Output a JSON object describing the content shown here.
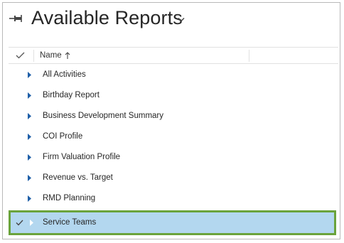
{
  "header": {
    "title": "Available Reports",
    "pin_icon": "pin-icon",
    "view_selector_icon": "chevron-down-icon"
  },
  "grid": {
    "select_all_icon": "checkmark-icon",
    "columns": [
      {
        "label": "Name",
        "sort": "ascending",
        "sort_icon": "arrow-up-icon"
      }
    ],
    "rows": [
      {
        "label": "All Activities",
        "selected": false
      },
      {
        "label": "Birthday Report",
        "selected": false
      },
      {
        "label": "Business Development Summary",
        "selected": false
      },
      {
        "label": "COI Profile",
        "selected": false
      },
      {
        "label": "Firm Valuation Profile",
        "selected": false
      },
      {
        "label": "Revenue vs. Target",
        "selected": false
      },
      {
        "label": "RMD Planning",
        "selected": false
      },
      {
        "label": "Service Teams",
        "selected": true
      }
    ]
  },
  "colors": {
    "selected_row": "#b3d7ef",
    "highlight_border": "#6aa33c",
    "expand_arrow": "#1f5fa8",
    "title_text": "#262626"
  }
}
